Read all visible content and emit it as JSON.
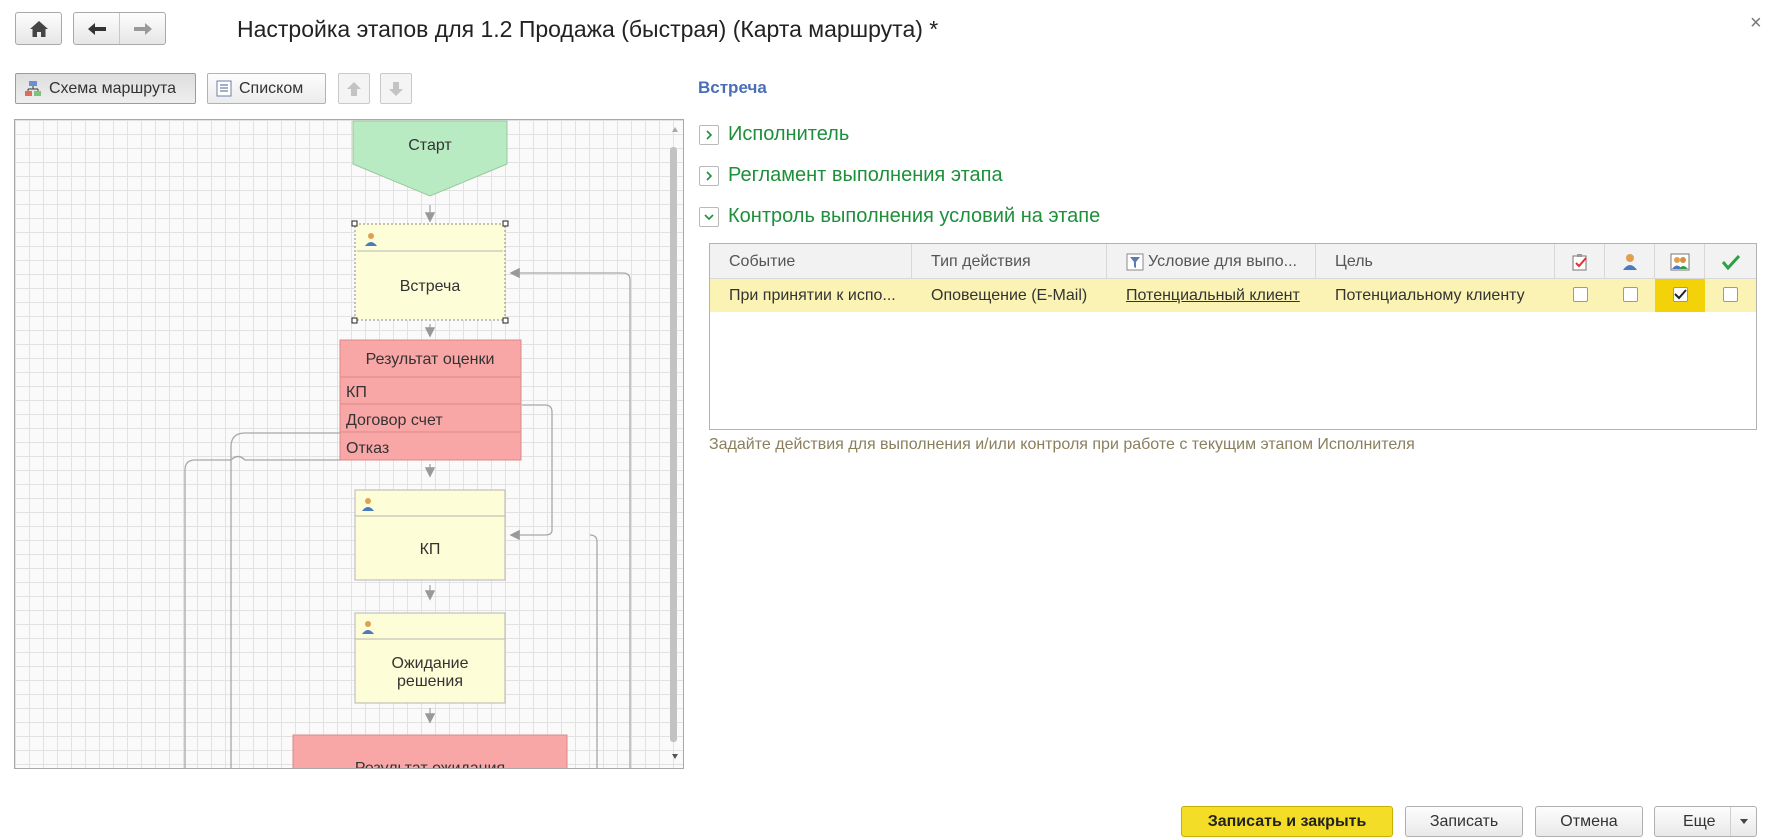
{
  "window": {
    "title": "Настройка этапов для 1.2 Продажа (быстрая) (Карта маршрута) *",
    "close_glyph": "×"
  },
  "nav": {
    "home_icon": "home-icon",
    "back_icon": "arrow-left-icon",
    "forward_icon": "arrow-right-icon"
  },
  "view_toolbar": {
    "schema_label": "Схема маршрута",
    "list_label": "Списком",
    "move_up_icon": "arrow-up-icon",
    "move_down_icon": "arrow-down-icon"
  },
  "diagram": {
    "start_label": "Старт",
    "meeting_label": "Встреча",
    "result_title": "Результат оценки",
    "result_options": [
      "КП",
      "Договор счет",
      "Отказ"
    ],
    "kp_label": "КП",
    "waiting_label_1": "Ожидание",
    "waiting_label_2": "решения",
    "waiting_result_label": "Результат ожидания",
    "colors": {
      "start": "#b9ebc3",
      "task": "#fdfdd7",
      "condition": "#f8a7a6"
    }
  },
  "details": {
    "stage_name": "Встреча",
    "sections": [
      {
        "label": "Исполнитель",
        "expanded": false
      },
      {
        "label": "Регламент выполнения этапа",
        "expanded": false
      },
      {
        "label": "Контроль выполнения условий на этапе",
        "expanded": true
      }
    ],
    "table": {
      "columns": [
        "Событие",
        "Тип действия",
        "Условие для выпо...",
        "Цель"
      ],
      "icon_columns": [
        "checklist-icon",
        "user-icon",
        "users-icon",
        "checkmark-icon"
      ],
      "rows": [
        {
          "event": "При принятии к испо...",
          "action_type": "Оповещение (E-Mail)",
          "condition": "Потенциальный клиент",
          "target": "Потенциальному клиенту",
          "checks": [
            false,
            false,
            true,
            false
          ]
        }
      ]
    },
    "hint": "Задайте действия для выполнения и/или контроля при работе с текущим этапом Исполнителя"
  },
  "footer": {
    "save_close": "Записать и закрыть",
    "save": "Записать",
    "cancel": "Отмена",
    "more": "Еще"
  }
}
